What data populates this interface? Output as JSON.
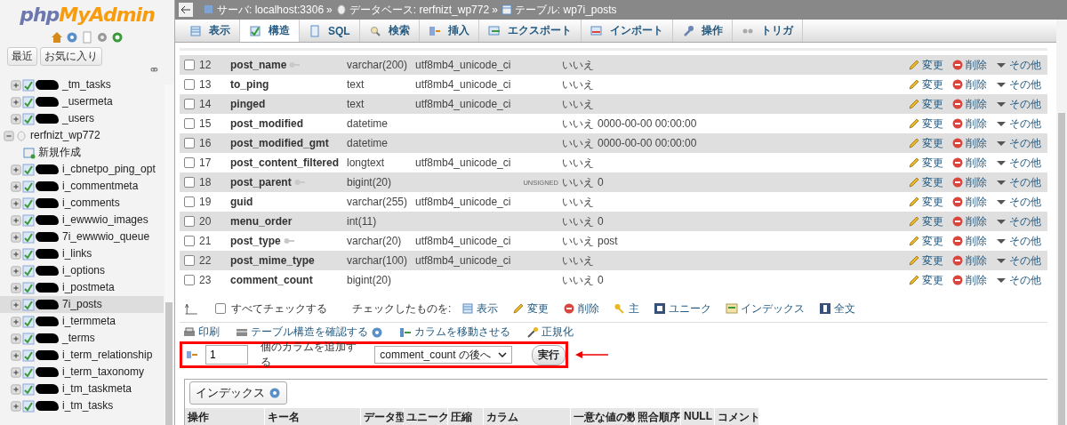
{
  "logo": {
    "php": "php",
    "myadmin": "MyAdmin"
  },
  "sidebar": {
    "buttons": [
      {
        "label": "最近"
      },
      {
        "label": "お気に入り"
      }
    ],
    "tree": [
      {
        "kind": "table",
        "label": "_tm_tasks",
        "redacted": true,
        "selected": false
      },
      {
        "kind": "table",
        "label": "_usermeta",
        "redacted": true,
        "selected": false
      },
      {
        "kind": "table",
        "label": "_users",
        "redacted": true,
        "selected": false
      },
      {
        "kind": "database",
        "label": "rerfnizt_wp772",
        "expanded": true,
        "children": [
          {
            "kind": "new",
            "label": "新規作成",
            "selected": false
          },
          {
            "kind": "table",
            "label": "i_cbnetpo_ping_opt",
            "redacted": true,
            "selected": false
          },
          {
            "kind": "table",
            "label": "i_commentmeta",
            "redacted": true,
            "selected": false
          },
          {
            "kind": "table",
            "label": "i_comments",
            "redacted": true,
            "selected": false
          },
          {
            "kind": "table",
            "label": "i_ewwwio_images",
            "redacted": true,
            "selected": false
          },
          {
            "kind": "table",
            "label": "7i_ewwwio_queue",
            "redacted": true,
            "selected": false
          },
          {
            "kind": "table",
            "label": "i_links",
            "redacted": true,
            "selected": false
          },
          {
            "kind": "table",
            "label": "i_options",
            "redacted": true,
            "selected": false
          },
          {
            "kind": "table",
            "label": "i_postmeta",
            "redacted": true,
            "selected": false
          },
          {
            "kind": "table",
            "label": "7i_posts",
            "redacted": true,
            "selected": true
          },
          {
            "kind": "table",
            "label": "i_termmeta",
            "redacted": true,
            "selected": false
          },
          {
            "kind": "table",
            "label": "_terms",
            "redacted": true,
            "selected": false
          },
          {
            "kind": "table",
            "label": "i_term_relationship",
            "redacted": true,
            "selected": false
          },
          {
            "kind": "table",
            "label": "i_term_taxonomy",
            "redacted": true,
            "selected": false
          },
          {
            "kind": "table",
            "label": "i_tm_taskmeta",
            "redacted": true,
            "selected": false
          },
          {
            "kind": "table",
            "label": "i_tm_tasks",
            "redacted": true,
            "selected": false
          }
        ]
      }
    ]
  },
  "breadcrumb": {
    "separator": "»",
    "items": [
      {
        "kind": "server",
        "text": "サーバ: localhost:3306"
      },
      {
        "kind": "database",
        "text": "データベース: rerfnizt_wp772"
      },
      {
        "kind": "table",
        "text": "テーブル: wp7i_posts"
      }
    ]
  },
  "tabs": [
    {
      "kind": "browse",
      "label": "表示",
      "selected": false
    },
    {
      "kind": "structure",
      "label": "構造",
      "selected": true
    },
    {
      "kind": "sql",
      "label": "SQL",
      "selected": false
    },
    {
      "kind": "search",
      "label": "検索",
      "selected": false
    },
    {
      "kind": "insert",
      "label": "挿入",
      "selected": false
    },
    {
      "kind": "export",
      "label": "エクスポート",
      "selected": false
    },
    {
      "kind": "import",
      "label": "インポート",
      "selected": false
    },
    {
      "kind": "operations",
      "label": "操作",
      "selected": false
    },
    {
      "kind": "triggers",
      "label": "トリガ",
      "selected": false
    }
  ],
  "structure": {
    "rows": [
      {
        "checked": false,
        "number": "12",
        "name": "post_name",
        "indexed": true,
        "type": "varchar(200)",
        "collation": "utf8mb4_unicode_ci",
        "null": "いいえ",
        "actions": {
          "change": "変更",
          "drop": "削除",
          "more": "その他"
        }
      },
      {
        "checked": false,
        "number": "13",
        "name": "to_ping",
        "indexed": false,
        "type": "text",
        "collation": "utf8mb4_unicode_ci",
        "null": "いいえ",
        "actions": {
          "change": "変更",
          "drop": "削除",
          "more": "その他"
        }
      },
      {
        "checked": false,
        "number": "14",
        "name": "pinged",
        "indexed": false,
        "type": "text",
        "collation": "utf8mb4_unicode_ci",
        "null": "いいえ",
        "actions": {
          "change": "変更",
          "drop": "削除",
          "more": "その他"
        }
      },
      {
        "checked": false,
        "number": "15",
        "name": "post_modified",
        "indexed": false,
        "type": "datetime",
        "null": "いいえ",
        "default": "0000-00-00 00:00:00",
        "actions": {
          "change": "変更",
          "drop": "削除",
          "more": "その他"
        }
      },
      {
        "checked": false,
        "number": "16",
        "name": "post_modified_gmt",
        "indexed": false,
        "type": "datetime",
        "null": "いいえ",
        "default": "0000-00-00 00:00:00",
        "actions": {
          "change": "変更",
          "drop": "削除",
          "more": "その他"
        }
      },
      {
        "checked": false,
        "number": "17",
        "name": "post_content_filtered",
        "indexed": false,
        "type": "longtext",
        "collation": "utf8mb4_unicode_ci",
        "null": "いいえ",
        "actions": {
          "change": "変更",
          "drop": "削除",
          "more": "その他"
        }
      },
      {
        "checked": false,
        "number": "18",
        "name": "post_parent",
        "indexed": true,
        "type": "bigint(20)",
        "attributes": "UNSIGNED",
        "null": "いいえ",
        "default": "0",
        "actions": {
          "change": "変更",
          "drop": "削除",
          "more": "その他"
        }
      },
      {
        "checked": false,
        "number": "19",
        "name": "guid",
        "indexed": false,
        "type": "varchar(255)",
        "collation": "utf8mb4_unicode_ci",
        "null": "いいえ",
        "actions": {
          "change": "変更",
          "drop": "削除",
          "more": "その他"
        }
      },
      {
        "checked": false,
        "number": "20",
        "name": "menu_order",
        "indexed": false,
        "type": "int(11)",
        "null": "いいえ",
        "default": "0",
        "actions": {
          "change": "変更",
          "drop": "削除",
          "more": "その他"
        }
      },
      {
        "checked": false,
        "number": "21",
        "name": "post_type",
        "indexed": true,
        "type": "varchar(20)",
        "collation": "utf8mb4_unicode_ci",
        "null": "いいえ",
        "default": "post",
        "actions": {
          "change": "変更",
          "drop": "削除",
          "more": "その他"
        }
      },
      {
        "checked": false,
        "number": "22",
        "name": "post_mime_type",
        "indexed": false,
        "type": "varchar(100)",
        "collation": "utf8mb4_unicode_ci",
        "null": "いいえ",
        "actions": {
          "change": "変更",
          "drop": "削除",
          "more": "その他"
        }
      },
      {
        "checked": false,
        "number": "23",
        "name": "comment_count",
        "indexed": false,
        "type": "bigint(20)",
        "null": "いいえ",
        "default": "0",
        "actions": {
          "change": "変更",
          "drop": "削除",
          "more": "その他"
        }
      }
    ]
  },
  "bulk": {
    "check_all": {
      "label": "すべてチェックする",
      "checked": false
    },
    "with_selected": "チェックしたものを:",
    "actions": [
      {
        "kind": "browse",
        "label": "表示"
      },
      {
        "kind": "change",
        "label": "変更"
      },
      {
        "kind": "drop",
        "label": "削除"
      },
      {
        "kind": "primary",
        "label": "主"
      },
      {
        "kind": "unique",
        "label": "ユニーク"
      },
      {
        "kind": "index",
        "label": "インデックス"
      },
      {
        "kind": "fulltext",
        "label": "全文"
      }
    ]
  },
  "links": [
    {
      "kind": "print",
      "label": "印刷"
    },
    {
      "kind": "propose",
      "label": "テーブル構造を確認する",
      "help": true
    },
    {
      "kind": "move",
      "label": "カラムを移動させる"
    },
    {
      "kind": "normalize",
      "label": "正規化"
    }
  ],
  "add_column": {
    "count": "1",
    "label": "個のカラムを追加する",
    "position": "comment_count の後へ",
    "submit": "実行",
    "highlighted": true
  },
  "indexes": {
    "legend": "インデックス",
    "columns": [
      "操作",
      "キー名",
      "データ型",
      "ユニーク",
      "圧縮",
      "カラム",
      "一意な値の数",
      "照合順序",
      "NULL",
      "コメント"
    ]
  }
}
